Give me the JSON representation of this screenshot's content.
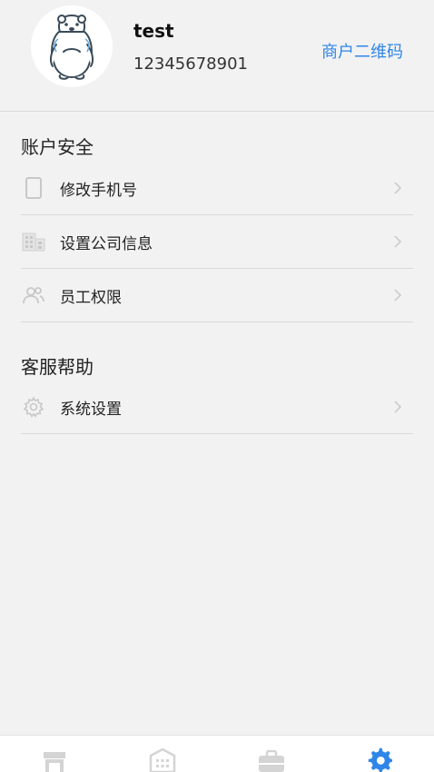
{
  "profile": {
    "name": "test",
    "phone": "12345678901",
    "qr_link": "商户二维码"
  },
  "sections": [
    {
      "title": "账户安全",
      "items": [
        {
          "label": "修改手机号",
          "icon": "phone-icon"
        },
        {
          "label": "设置公司信息",
          "icon": "building-icon"
        },
        {
          "label": "员工权限",
          "icon": "people-icon"
        }
      ]
    },
    {
      "title": "客服帮助",
      "items": [
        {
          "label": "系统设置",
          "icon": "gear-icon"
        }
      ]
    }
  ],
  "tabbar": {
    "tabs": [
      {
        "icon": "store-icon",
        "active": false
      },
      {
        "icon": "office-building-icon",
        "active": false
      },
      {
        "icon": "briefcase-icon",
        "active": false
      },
      {
        "icon": "settings-gear-icon",
        "active": true
      }
    ]
  },
  "colors": {
    "accent": "#2f86e8",
    "background": "#f2f2f2",
    "divider": "#d9d9d9",
    "icon_gray": "#c8c8c8"
  }
}
